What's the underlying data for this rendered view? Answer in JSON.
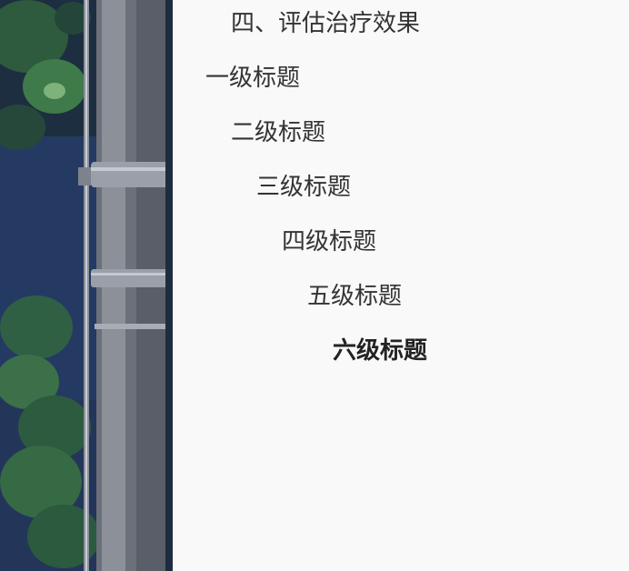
{
  "background_image": {
    "icon": "photo-utility-pole-foliage"
  },
  "outline": {
    "current_heading": "四、评估治疗效果",
    "items": [
      {
        "level": 1,
        "label": "一级标题"
      },
      {
        "level": 2,
        "label": "二级标题"
      },
      {
        "level": 3,
        "label": "三级标题"
      },
      {
        "level": 4,
        "label": "四级标题"
      },
      {
        "level": 5,
        "label": "五级标题"
      },
      {
        "level": 6,
        "label": "六级标题"
      }
    ]
  },
  "colors": {
    "panel_background": "#f9f9f9",
    "text": "#333333"
  }
}
